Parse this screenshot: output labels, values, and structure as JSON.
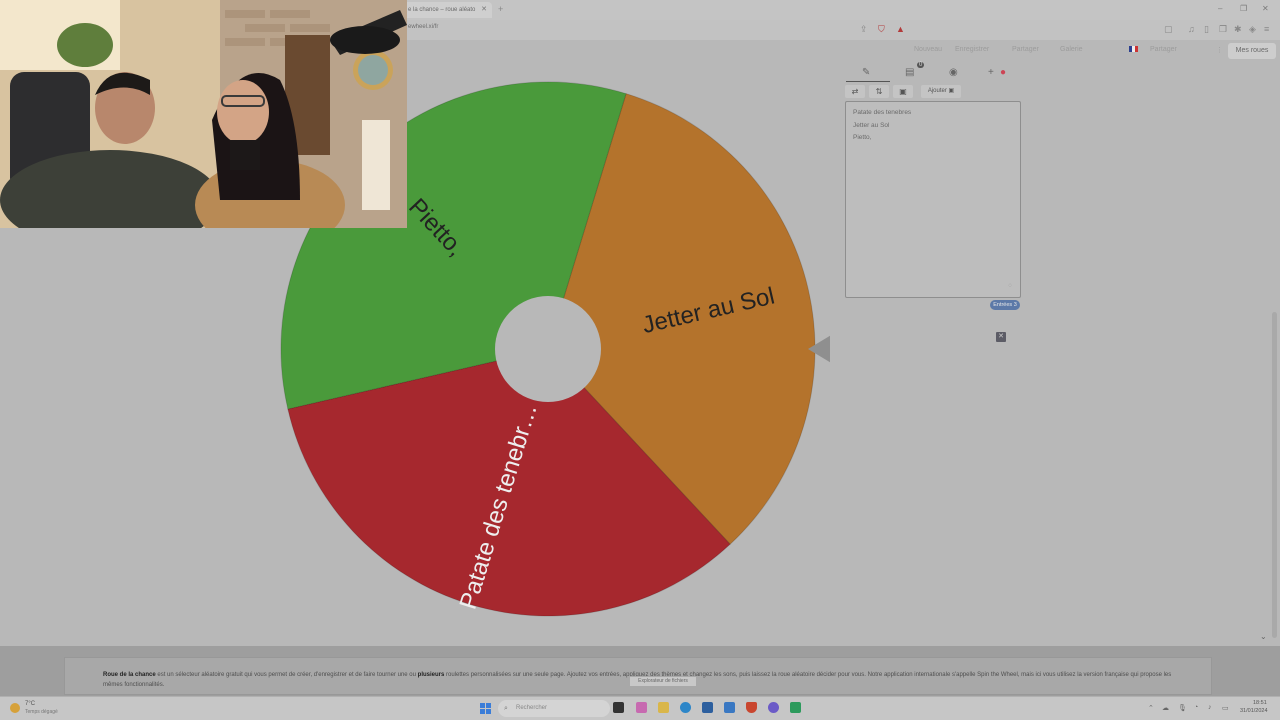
{
  "browser": {
    "tab_title": "e la chance – roue aléato",
    "url": "ewheel.xi/fr"
  },
  "nav": {
    "items": [
      "Nouveau",
      "Enregistrer",
      "Partager",
      "Galerie",
      "Partager"
    ],
    "language_flag": "fr",
    "my_wheels": "Mes roues"
  },
  "wheel": {
    "segments": [
      {
        "label": "Jetter au Sol",
        "color": "#b4732c",
        "text_color": "#222222"
      },
      {
        "label": "Patate des tenebr…",
        "color": "#a6282e",
        "text_color": "#eeeeee"
      },
      {
        "label": "Pietto,",
        "color": "#4a9a3b",
        "text_color": "#222222"
      }
    ],
    "hub_color": "#b8b8b8",
    "pointer_color": "#8f8f8f"
  },
  "editor": {
    "add_label": "Ajouter",
    "entries": [
      "Patate des tenebres",
      "Jetter au Sol",
      "Pietto,"
    ],
    "entries_count": "Entrées 3",
    "badge_count": "0"
  },
  "footer": {
    "brand": "Roue de la chance",
    "text_1": " est un sélecteur aléatoire gratuit qui vous permet de créer, d'enregistrer et de faire tourner une ou ",
    "bold_2": "plusieurs",
    "text_2": " roulettes personnalisées sur une seule page. Ajoutez vos entrées, appliquez des thèmes et changez les sons, puis laissez la roue aléatoire décider pour vous. Notre application internationale s'appelle Spin the Wheel, mais ici vous utilisez la version française qui propose les mêmes fonctionnalités.",
    "tooltip": "Explorateur de fichiers"
  },
  "taskbar": {
    "temperature": "7°C",
    "weather": "Temps dégagé",
    "search_placeholder": "Rechercher",
    "time": "18:51",
    "date": "31/01/2024"
  },
  "colors": {
    "page_bg": "#b8b8b8",
    "accent_blue": "#5c79a8",
    "brave_red": "#b23a3a"
  }
}
